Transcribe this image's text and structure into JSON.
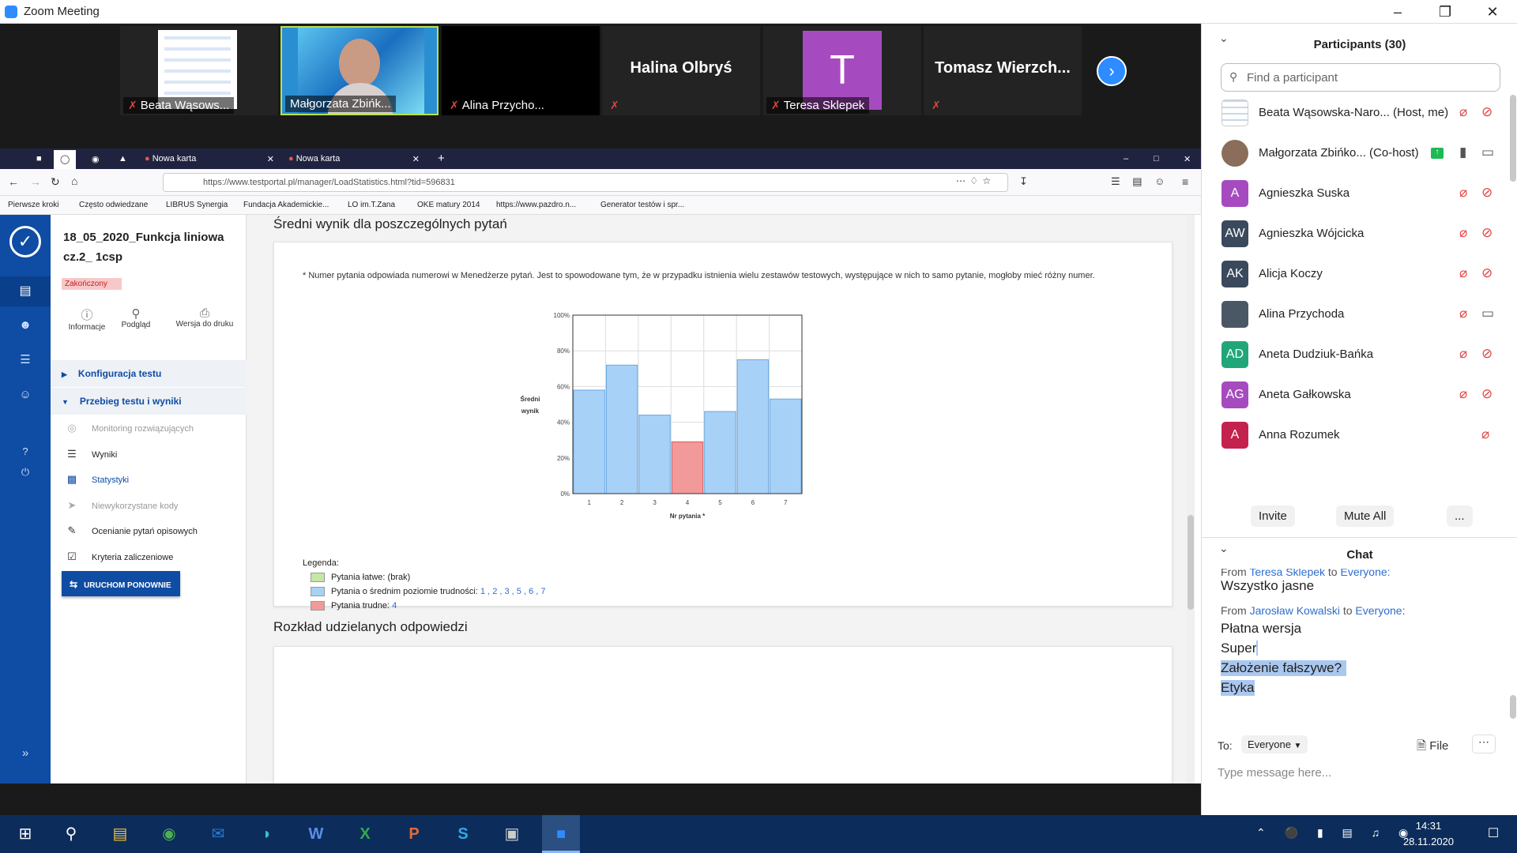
{
  "zoom": {
    "title": "Zoom Meeting",
    "gallery": [
      {
        "name": "Beata Wąsows...",
        "muted": true,
        "center": ""
      },
      {
        "name": "Małgorzata Zbińk...",
        "muted": false,
        "center": ""
      },
      {
        "name": "Alina Przycho...",
        "muted": true,
        "center": ""
      },
      {
        "name": "",
        "muted": true,
        "center": "Halina Olbryś"
      },
      {
        "name": "Teresa Sklepek",
        "muted": true,
        "center": ""
      },
      {
        "name": "",
        "muted": true,
        "center": "Tomasz  Wierzch..."
      }
    ],
    "teresa_initial": "T",
    "participants_header": "Participants (30)",
    "search_placeholder": "Find a participant",
    "participants": [
      {
        "name": "Beata Wąsowska-Naro... (Host, me)",
        "initials": "",
        "color": "#ffffff"
      },
      {
        "name": "Małgorzata Zbińko... (Co-host)",
        "initials": "",
        "color": "#8a6d5a"
      },
      {
        "name": "Agnieszka Suska",
        "initials": "A",
        "color": "#a64bbf"
      },
      {
        "name": "Agnieszka Wójcicka",
        "initials": "AW",
        "color": "#3a4a5c"
      },
      {
        "name": "Alicja Koczy",
        "initials": "AK",
        "color": "#3a4a5c"
      },
      {
        "name": "Alina Przychoda",
        "initials": "",
        "color": "#4a5866"
      },
      {
        "name": "Aneta Dudziuk-Bańka",
        "initials": "AD",
        "color": "#21a67a"
      },
      {
        "name": "Aneta Gałkowska",
        "initials": "AG",
        "color": "#a64bbf"
      },
      {
        "name": "Anna Rozumek",
        "initials": "A",
        "color": "#c4214f"
      }
    ],
    "buttons": {
      "invite": "Invite",
      "mute_all": "Mute All",
      "more": "..."
    },
    "chat_header": "Chat",
    "chat": {
      "prev_from": "From",
      "prev_sender": "Teresa Sklepek",
      "prev_to": "to",
      "prev_target": "Everyone:",
      "prev_msg": "Wszystko jasne",
      "from": "From",
      "sender": "Jarosław Kowalski",
      "to": "to",
      "target": "Everyone",
      "msgs": [
        "Płatna wersja",
        "Super",
        "Założenie fałszywe?",
        "Etyka"
      ]
    },
    "to_label": "To:",
    "to_value": "Everyone",
    "file_label": "File",
    "message_placeholder": "Type message here..."
  },
  "browser": {
    "tabs": [
      "Nowa karta",
      "Nowa karta"
    ],
    "url": "https://www.testportal.pl/manager/LoadStatistics.html?tid=596831",
    "bookmarks": [
      "Pierwsze kroki",
      "Często odwiedzane",
      "LIBRUS Synergia",
      "Fundacja Akademickie...",
      "LO im.T.Zana",
      "OKE matury 2014",
      "https://www.pazdro.n...",
      "Generator testów i spr..."
    ]
  },
  "testportal": {
    "test_title": "18_05_2020_Funkcja liniowa cz.2_ 1csp",
    "status": "Zakończony",
    "actions": [
      "Informacje",
      "Podgląd",
      "Wersja do druku"
    ],
    "section1": "Konfiguracja testu",
    "section2": "Przebieg testu i wyniki",
    "menu": [
      "Monitoring rozwiązujących",
      "Wyniki",
      "Statystyki",
      "Niewykorzystane kody",
      "Ocenianie pytań opisowych",
      "Kryteria zaliczeniowe"
    ],
    "restart_button": "URUCHOM PONOWNIE",
    "heading": "Średni wynik dla poszczególnych pytań",
    "note": "* Numer pytania odpowiada numerowi w Menedżerze pytań. Jest to spowodowane tym, że w przypadku istnienia wielu zestawów testowych, występujące w nich to samo pytanie, mogłoby mieć różny numer.",
    "legend_title": "Legenda:",
    "legend_easy": "Pytania łatwe: (brak)",
    "legend_medium": "Pytania o średnim poziomie trudności:",
    "legend_medium_items": "1 , 2 , 3 , 5 , 6 , 7",
    "legend_hard": "Pytania trudne:",
    "legend_hard_items": "4",
    "heading2": "Rozkład udzielanych odpowiedzi",
    "color_medium": "#a8d1f7",
    "color_hard": "#f29a9a",
    "color_easy": "#c6e6a5"
  },
  "chart_data": {
    "type": "bar",
    "categories": [
      "1",
      "2",
      "3",
      "4",
      "5",
      "6",
      "7"
    ],
    "values": [
      58,
      72,
      44,
      29,
      46,
      75,
      53
    ],
    "difficulty": [
      "medium",
      "medium",
      "medium",
      "hard",
      "medium",
      "medium",
      "medium"
    ],
    "ylabel": "Średni wynik",
    "xlabel": "Nr pytania *",
    "ylim": [
      0,
      100
    ],
    "yticks": [
      "0%",
      "20%",
      "40%",
      "60%",
      "80%",
      "100%"
    ],
    "grid": true
  },
  "taskbar": {
    "time": "14:31",
    "date": "28.11.2020"
  }
}
